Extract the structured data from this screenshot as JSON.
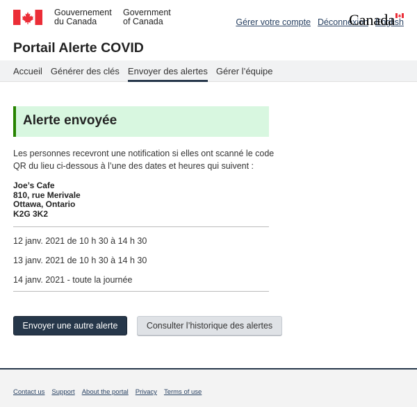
{
  "header": {
    "gov_fr_line1": "Gouvernement",
    "gov_fr_line2": "du Canada",
    "gov_en_line1": "Government",
    "gov_en_line2": "of Canada",
    "links": [
      "Gérer votre compte",
      "Déconnexion",
      "English"
    ],
    "app_title": "Portail Alerte COVID"
  },
  "nav": {
    "items": [
      "Accueil",
      "Générer des clés",
      "Envoyer des alertes",
      "Gérer l’équipe"
    ],
    "active": "Envoyer des alertes"
  },
  "alert": {
    "title": "Alerte envoyée"
  },
  "intro": "Les personnes recevront une notification si elles ont scanné le code QR du lieu ci-dessous à l’une des dates et heures qui suivent :",
  "venue": {
    "name": "Joe’s Cafe",
    "street": "810, rue Merivale",
    "city": "Ottawa, Ontario",
    "postal": "K2G 3K2"
  },
  "dates": [
    "12 janv. 2021 de 10 h 30 à 14 h 30",
    "13 janv. 2021 de 10 h 30 à 14 h 30",
    "14 janv. 2021 - toute la journée"
  ],
  "buttons": {
    "primary": "Envoyer une autre alerte",
    "secondary": "Consulter l’historique des alertes"
  },
  "footer": {
    "links": [
      "Contact us",
      "Support",
      "About the portal",
      "Privacy",
      "Terms of use"
    ],
    "wordmark": "Canada"
  },
  "colors": {
    "flag_red": "#eb2d37",
    "nav_active": "#26374a",
    "alert_bg": "#d8f7e0",
    "alert_border": "#278400",
    "link": "#284162"
  }
}
